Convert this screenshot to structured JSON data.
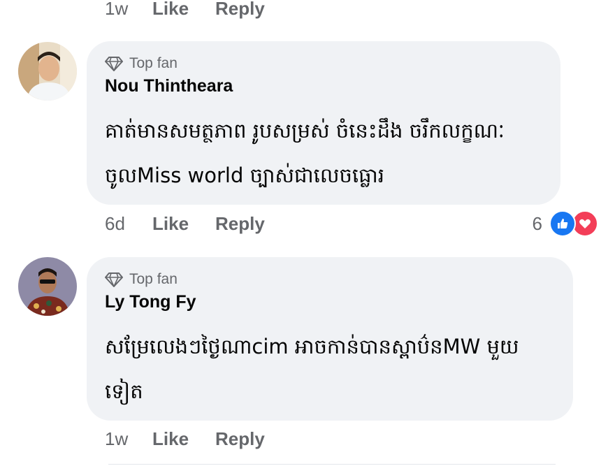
{
  "top_actions": {
    "time": "1w",
    "like": "Like",
    "reply": "Reply"
  },
  "comments": [
    {
      "badge": "Top fan",
      "author": "Nou Thintheara",
      "text": "គាត់មានសមត្ថភាព រូបសម្រស់ ចំនេះដឹង  ចរឹកលក្ខណៈចូលMiss world ច្បាស់ជាលេចធ្លោរ",
      "time": "6d",
      "like": "Like",
      "reply": "Reply",
      "reaction_count": "6",
      "reaction_icons": [
        "like-icon",
        "love-icon"
      ]
    },
    {
      "badge": "Top fan",
      "author": "Ly Tong Fy",
      "text": "សម្រែលេងៗថ្ងៃណាcim អាចកាន់បានស្ពាប៌នMW មួយទៀត",
      "time": "1w",
      "like": "Like",
      "reply": "Reply"
    }
  ],
  "colors": {
    "bubble": "#f0f2f5",
    "meta_text": "#65676b",
    "like_blue": "#1877f2",
    "love_red": "#f33e58"
  }
}
